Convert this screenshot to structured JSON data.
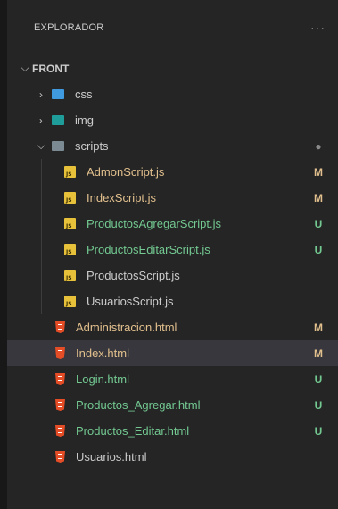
{
  "explorer": {
    "title": "EXPLORADOR",
    "more": "···",
    "root": "FRONT",
    "folders": {
      "css": "css",
      "img": "img",
      "scripts": "scripts"
    },
    "scripts_files": [
      {
        "name": "AdmonScript.js",
        "status": "M"
      },
      {
        "name": "IndexScript.js",
        "status": "M"
      },
      {
        "name": "ProductosAgregarScript.js",
        "status": "U"
      },
      {
        "name": "ProductosEditarScript.js",
        "status": "U"
      },
      {
        "name": "ProductosScript.js",
        "status": ""
      },
      {
        "name": "UsuariosScript.js",
        "status": ""
      }
    ],
    "html_files": [
      {
        "name": "Administracion.html",
        "status": "M"
      },
      {
        "name": "Index.html",
        "status": "M"
      },
      {
        "name": "Login.html",
        "status": "U"
      },
      {
        "name": "Productos_Agregar.html",
        "status": "U"
      },
      {
        "name": "Productos_Editar.html",
        "status": "U"
      },
      {
        "name": "Usuarios.html",
        "status": ""
      }
    ],
    "folder_dot": "●",
    "colors": {
      "modified": "#e2c08d",
      "untracked": "#73c991",
      "selected": "#37373d"
    }
  }
}
